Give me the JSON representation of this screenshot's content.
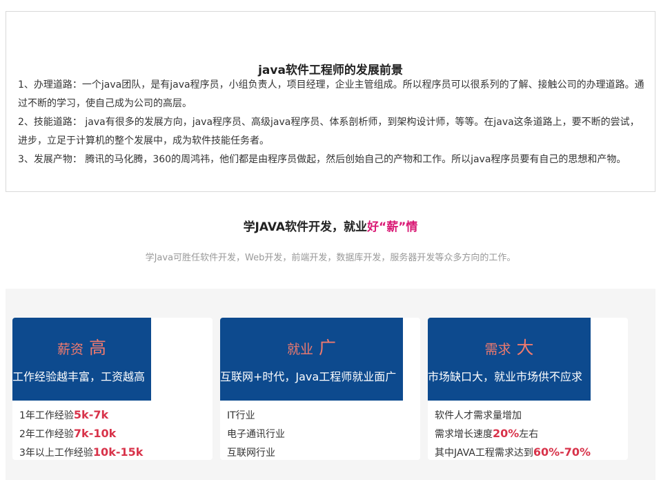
{
  "intro": {
    "title": "java软件工程师的发展前景",
    "paragraphs": [
      "1、办理道路：一个java团队，是有java程序员，小组负责人，项目经理，企业主管组成。所以程序员可以很系列的了解、接触公司的办理道路。通过不断的学习，使自己成为公司的高层。",
      "2、技能道路： java有很多的发展方向，java程序员、高级java程序员、体系剖析师，到架构设计师，等等。在java这条道路上，要不断的尝试，进步，立足于计算机的整个发展中，成为软件技能任务者。",
      "3、发展产物： 腾讯的马化腾，360的周鸿祎，他们都是由程序员做起，然后创始自己的产物和工作。所以java程序员要有自己的思想和产物。"
    ]
  },
  "section": {
    "title_prefix": "学JAVA软件开发，就业",
    "title_highlight": "好“薪”情",
    "subtitle": "学Java可胜任软件开发，Web开发，前端开发，数据库开发，服务器开发等众多方向的工作。"
  },
  "cards": [
    {
      "title": "薪资",
      "title_big": "高",
      "desc": "工作经验越丰富，工资越高",
      "items": [
        {
          "prefix": "1年工作经验",
          "value": "5k-7k",
          "suffix": ""
        },
        {
          "prefix": "2年工作经验",
          "value": "7k-10k",
          "suffix": ""
        },
        {
          "prefix": "3年以上工作经验",
          "value": "10k-15k",
          "suffix": ""
        }
      ]
    },
    {
      "title": "就业",
      "title_big": "广",
      "desc": "互联网+时代，Java工程师就业面广",
      "items": [
        {
          "prefix": "IT行业",
          "value": "",
          "suffix": ""
        },
        {
          "prefix": "电子通讯行业",
          "value": "",
          "suffix": ""
        },
        {
          "prefix": "互联网行业",
          "value": "",
          "suffix": ""
        }
      ]
    },
    {
      "title": "需求",
      "title_big": "大",
      "desc": "市场缺口大，就业市场供不应求",
      "items": [
        {
          "prefix": "软件人才需求量增加",
          "value": "",
          "suffix": ""
        },
        {
          "prefix": "需求增长速度",
          "value": "20%",
          "suffix": "左右"
        },
        {
          "prefix": "其中JAVA工程需求达到",
          "value": "60%-70%",
          "suffix": ""
        }
      ]
    }
  ],
  "colors": {
    "banner_bg": "#0d4a8e",
    "banner_title": "#f07a6e",
    "highlight": "#d91a75",
    "value_red": "#d8334a"
  }
}
